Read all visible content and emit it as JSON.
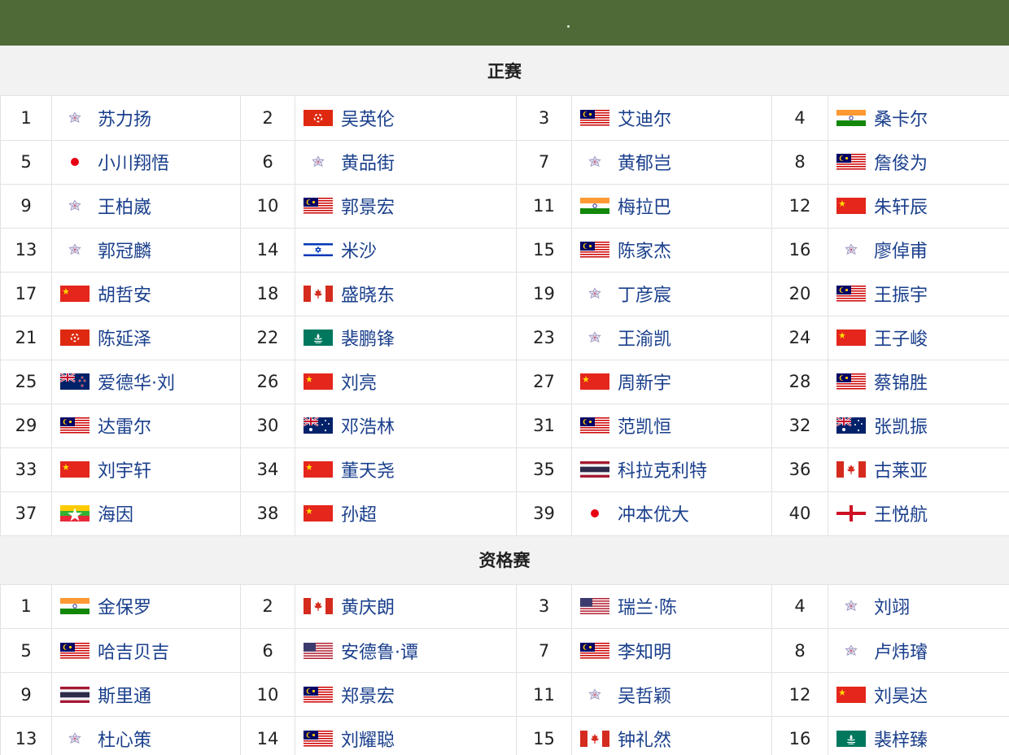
{
  "sections": [
    {
      "title": "正赛",
      "players": [
        {
          "seed": "1",
          "name": "苏力扬",
          "flag": "tpe-flower-icon"
        },
        {
          "seed": "2",
          "name": "吴英伦",
          "flag": "hong-kong-flag-icon"
        },
        {
          "seed": "3",
          "name": "艾迪尔",
          "flag": "malaysia-flag-icon"
        },
        {
          "seed": "4",
          "name": "桑卡尔",
          "flag": "india-flag-icon"
        },
        {
          "seed": "5",
          "name": "小川翔悟",
          "flag": "japan-dot-icon"
        },
        {
          "seed": "6",
          "name": "黄品街",
          "flag": "tpe-flower-icon"
        },
        {
          "seed": "7",
          "name": "黄郁岂",
          "flag": "tpe-flower-icon"
        },
        {
          "seed": "8",
          "name": "詹俊为",
          "flag": "malaysia-flag-icon"
        },
        {
          "seed": "9",
          "name": "王柏崴",
          "flag": "tpe-flower-icon"
        },
        {
          "seed": "10",
          "name": "郭景宏",
          "flag": "malaysia-flag-icon"
        },
        {
          "seed": "11",
          "name": "梅拉巴",
          "flag": "india-flag-icon"
        },
        {
          "seed": "12",
          "name": "朱轩辰",
          "flag": "china-flag-icon"
        },
        {
          "seed": "13",
          "name": "郭冠麟",
          "flag": "tpe-flower-icon"
        },
        {
          "seed": "14",
          "name": "米沙",
          "flag": "israel-flag-icon"
        },
        {
          "seed": "15",
          "name": "陈家杰",
          "flag": "malaysia-flag-icon"
        },
        {
          "seed": "16",
          "name": "廖倬甫",
          "flag": "tpe-flower-icon"
        },
        {
          "seed": "17",
          "name": "胡哲安",
          "flag": "china-flag-icon"
        },
        {
          "seed": "18",
          "name": "盛晓东",
          "flag": "canada-flag-icon"
        },
        {
          "seed": "19",
          "name": "丁彦宸",
          "flag": "tpe-flower-icon"
        },
        {
          "seed": "20",
          "name": "王振宇",
          "flag": "malaysia-flag-icon"
        },
        {
          "seed": "21",
          "name": "陈延泽",
          "flag": "hong-kong-flag-icon"
        },
        {
          "seed": "22",
          "name": "裴鹏锋",
          "flag": "macau-flag-icon"
        },
        {
          "seed": "23",
          "name": "王渝凯",
          "flag": "tpe-flower-icon"
        },
        {
          "seed": "24",
          "name": "王子峻",
          "flag": "china-flag-icon"
        },
        {
          "seed": "25",
          "name": "爱德华·刘",
          "flag": "new-zealand-flag-icon"
        },
        {
          "seed": "26",
          "name": "刘亮",
          "flag": "china-flag-icon"
        },
        {
          "seed": "27",
          "name": "周新宇",
          "flag": "china-flag-icon"
        },
        {
          "seed": "28",
          "name": "蔡锦胜",
          "flag": "malaysia-flag-icon"
        },
        {
          "seed": "29",
          "name": "达雷尔",
          "flag": "malaysia-flag-icon"
        },
        {
          "seed": "30",
          "name": "邓浩林",
          "flag": "australia-flag-icon"
        },
        {
          "seed": "31",
          "name": "范凯恒",
          "flag": "malaysia-flag-icon"
        },
        {
          "seed": "32",
          "name": "张凯振",
          "flag": "australia-flag-icon"
        },
        {
          "seed": "33",
          "name": "刘宇轩",
          "flag": "china-flag-icon"
        },
        {
          "seed": "34",
          "name": "董天尧",
          "flag": "china-flag-icon"
        },
        {
          "seed": "35",
          "name": "科拉克利特",
          "flag": "thailand-flag-icon"
        },
        {
          "seed": "36",
          "name": "古莱亚",
          "flag": "canada-flag-icon"
        },
        {
          "seed": "37",
          "name": "海因",
          "flag": "myanmar-flag-icon"
        },
        {
          "seed": "38",
          "name": "孙超",
          "flag": "china-flag-icon"
        },
        {
          "seed": "39",
          "name": "冲本优大",
          "flag": "japan-dot-icon"
        },
        {
          "seed": "40",
          "name": "王悦航",
          "flag": "england-flag-icon"
        }
      ]
    },
    {
      "title": "资格赛",
      "players": [
        {
          "seed": "1",
          "name": "金保罗",
          "flag": "india-flag-icon"
        },
        {
          "seed": "2",
          "name": "黄庆朗",
          "flag": "canada-flag-icon"
        },
        {
          "seed": "3",
          "name": "瑞兰·陈",
          "flag": "usa-flag-icon"
        },
        {
          "seed": "4",
          "name": "刘翊",
          "flag": "tpe-flower-icon"
        },
        {
          "seed": "5",
          "name": "哈吉贝吉",
          "flag": "malaysia-flag-icon"
        },
        {
          "seed": "6",
          "name": "安德鲁·谭",
          "flag": "usa-flag-icon"
        },
        {
          "seed": "7",
          "name": "李知明",
          "flag": "malaysia-flag-icon"
        },
        {
          "seed": "8",
          "name": "卢炜璿",
          "flag": "tpe-flower-icon"
        },
        {
          "seed": "9",
          "name": "斯里通",
          "flag": "thailand-flag-icon"
        },
        {
          "seed": "10",
          "name": "郑景宏",
          "flag": "malaysia-flag-icon"
        },
        {
          "seed": "11",
          "name": "吴哲颖",
          "flag": "tpe-flower-icon"
        },
        {
          "seed": "12",
          "name": "刘昊达",
          "flag": "china-flag-icon"
        },
        {
          "seed": "13",
          "name": "杜心策",
          "flag": "tpe-flower-icon"
        },
        {
          "seed": "14",
          "name": "刘耀聪",
          "flag": "malaysia-flag-icon"
        },
        {
          "seed": "15",
          "name": "钟礼然",
          "flag": "canada-flag-icon"
        },
        {
          "seed": "16",
          "name": "裴梓臻",
          "flag": "macau-flag-icon"
        }
      ]
    }
  ],
  "colors": {
    "topbar": "#4f6a37",
    "header_bg": "#f2f2f2",
    "name_text": "#1a3f8c",
    "border": "#e2e2e2"
  }
}
